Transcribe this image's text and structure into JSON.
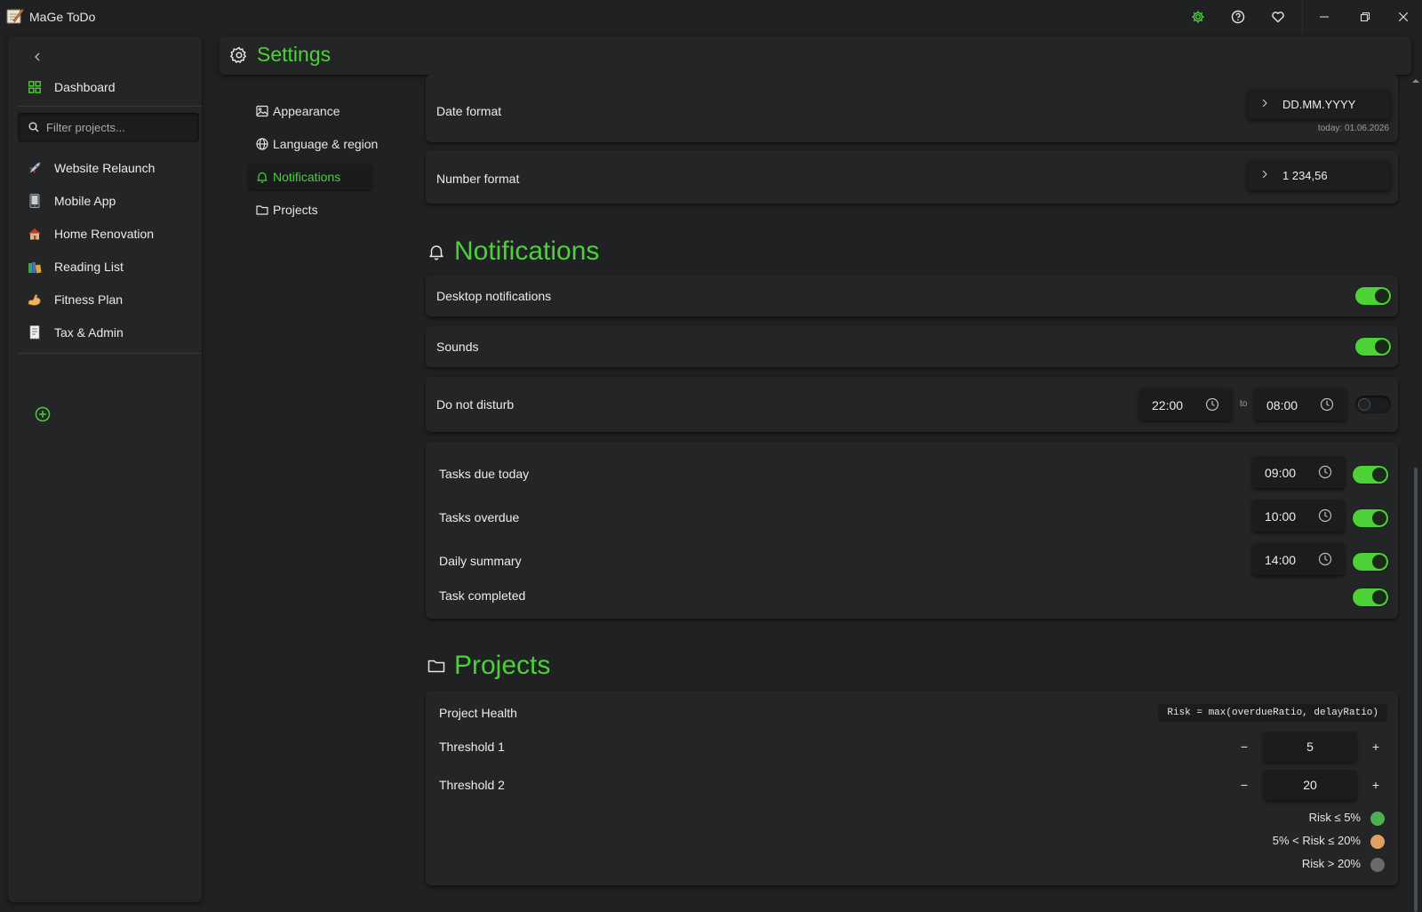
{
  "window": {
    "title": "MaGe ToDo",
    "colors": {
      "accent": "#4cd137",
      "background": "#1f2123",
      "panel": "#232527"
    }
  },
  "sidebar": {
    "dashboard_label": "Dashboard",
    "filter_placeholder": "Filter projects...",
    "projects": [
      {
        "label": "Website Relaunch",
        "icon": "rocket-emoji"
      },
      {
        "label": "Mobile App",
        "icon": "phone-emoji"
      },
      {
        "label": "Home Renovation",
        "icon": "house-emoji"
      },
      {
        "label": "Reading List",
        "icon": "books-emoji"
      },
      {
        "label": "Fitness Plan",
        "icon": "flexed-arm-emoji"
      },
      {
        "label": "Tax & Admin",
        "icon": "receipt-emoji"
      }
    ]
  },
  "header": {
    "title": "Settings"
  },
  "settings_nav": [
    {
      "label": "Appearance",
      "icon": "image-icon"
    },
    {
      "label": "Language & region",
      "icon": "globe-icon"
    },
    {
      "label": "Notifications",
      "icon": "bell-icon",
      "active": true
    },
    {
      "label": "Projects",
      "icon": "folder-icon"
    }
  ],
  "language": {
    "date_format": {
      "label": "Date format",
      "value": "DD.MM.YYYY",
      "hint": "today: 01.06.2026"
    },
    "number_format": {
      "label": "Number format",
      "value": "1 234,56"
    }
  },
  "notifications": {
    "title": "Notifications",
    "desktop": {
      "label": "Desktop notifications",
      "enabled": true
    },
    "sounds": {
      "label": "Sounds",
      "enabled": true
    },
    "dnd": {
      "label": "Do not disturb",
      "from": "22:00",
      "to_label": "to",
      "to": "08:00",
      "enabled": false
    },
    "reminders": [
      {
        "label": "Tasks due today",
        "time": "09:00",
        "enabled": true
      },
      {
        "label": "Tasks overdue",
        "time": "10:00",
        "enabled": true
      },
      {
        "label": "Daily summary",
        "time": "14:00",
        "enabled": true
      },
      {
        "label": "Task completed",
        "enabled": true
      }
    ]
  },
  "projects": {
    "title": "Projects",
    "health_label": "Project Health",
    "formula": "Risk = max(overdueRatio, delayRatio)",
    "threshold1": {
      "label": "Threshold 1",
      "value": "5",
      "minus": "−",
      "plus": "+"
    },
    "threshold2": {
      "label": "Threshold 2",
      "value": "20",
      "minus": "−",
      "plus": "+"
    },
    "legend": [
      {
        "label": "Risk ≤ 5%",
        "color": "#4caf50"
      },
      {
        "label": "5% < Risk ≤ 20%",
        "color": "#e0a060"
      },
      {
        "label": "Risk > 20%",
        "color": "#6a6a6a"
      }
    ]
  }
}
